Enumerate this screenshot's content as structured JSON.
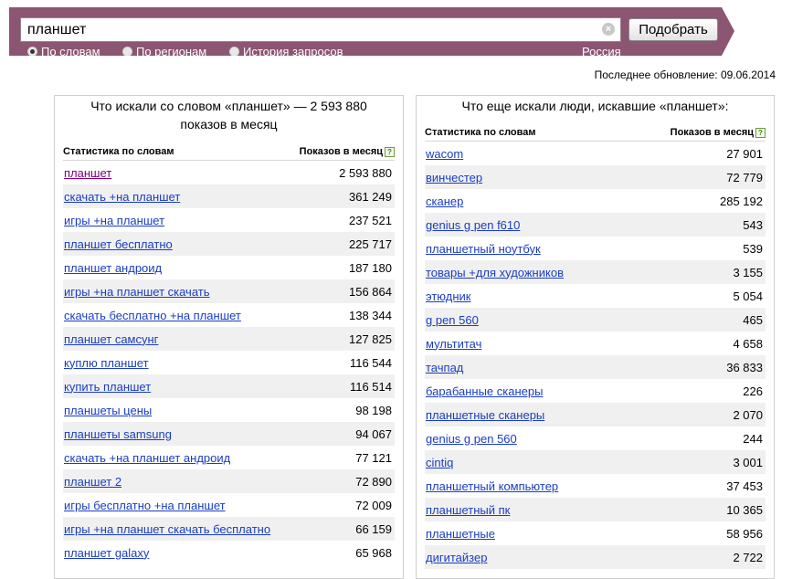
{
  "search": {
    "query": "планшет",
    "clear_symbol": "×",
    "submit_label": "Подобрать"
  },
  "modes": [
    {
      "label": "По словам",
      "selected": true
    },
    {
      "label": "По регионам",
      "selected": false
    },
    {
      "label": "История запросов",
      "selected": false
    }
  ],
  "region": "Россия",
  "updated": "Последнее обновление: 09.06.2014",
  "colors": {
    "banner": "#8c5571",
    "link": "#1a3dc1",
    "visited_link": "#800080",
    "row_alt": "#f0f0f0"
  },
  "left": {
    "title": "Что искали со словом «планшет» — 2 593 880 показов в месяц",
    "col_words": "Статистика по словам",
    "col_shows": "Показов в месяц",
    "help": "?",
    "rows": [
      {
        "phrase": "планшет",
        "count": "2 593 880"
      },
      {
        "phrase": "скачать +на планшет",
        "count": "361 249"
      },
      {
        "phrase": "игры +на планшет",
        "count": "237 521"
      },
      {
        "phrase": "планшет бесплатно",
        "count": "225 717"
      },
      {
        "phrase": "планшет андроид",
        "count": "187 180"
      },
      {
        "phrase": "игры +на планшет скачать",
        "count": "156 864"
      },
      {
        "phrase": "скачать бесплатно +на планшет",
        "count": "138 344"
      },
      {
        "phrase": "планшет самсунг",
        "count": "127 825"
      },
      {
        "phrase": "куплю планшет",
        "count": "116 544"
      },
      {
        "phrase": "купить планшет",
        "count": "116 514"
      },
      {
        "phrase": "планшеты цены",
        "count": "98 198"
      },
      {
        "phrase": "планшеты samsung",
        "count": "94 067"
      },
      {
        "phrase": "скачать +на планшет андроид",
        "count": "77 121"
      },
      {
        "phrase": "планшет 2",
        "count": "72 890"
      },
      {
        "phrase": "игры бесплатно +на планшет",
        "count": "72 009"
      },
      {
        "phrase": "игры +на планшет скачать бесплатно",
        "count": "66 159"
      },
      {
        "phrase": "планшет galaxy",
        "count": "65 968"
      }
    ]
  },
  "right": {
    "title": "Что еще искали люди, искавшие «планшет»:",
    "col_words": "Статистика по словам",
    "col_shows": "Показов в месяц",
    "help": "?",
    "rows": [
      {
        "phrase": "wacom",
        "count": "27 901"
      },
      {
        "phrase": "винчестер",
        "count": "72 779"
      },
      {
        "phrase": "сканер",
        "count": "285 192"
      },
      {
        "phrase": "genius g pen f610",
        "count": "543"
      },
      {
        "phrase": "планшетный ноутбук",
        "count": "539"
      },
      {
        "phrase": "товары +для художников",
        "count": "3 155"
      },
      {
        "phrase": "этюдник",
        "count": "5 054"
      },
      {
        "phrase": "g pen 560",
        "count": "465"
      },
      {
        "phrase": "мультитач",
        "count": "4 658"
      },
      {
        "phrase": "тачпад",
        "count": "36 833"
      },
      {
        "phrase": "барабанные сканеры",
        "count": "226"
      },
      {
        "phrase": "планшетные сканеры",
        "count": "2 070"
      },
      {
        "phrase": "genius g pen 560",
        "count": "244"
      },
      {
        "phrase": "cintiq",
        "count": "3 001"
      },
      {
        "phrase": "планшетный компьютер",
        "count": "37 453"
      },
      {
        "phrase": "планшетный пк",
        "count": "10 365"
      },
      {
        "phrase": "планшетные",
        "count": "58 956"
      },
      {
        "phrase": "дигитайзер",
        "count": "2 722"
      }
    ]
  }
}
